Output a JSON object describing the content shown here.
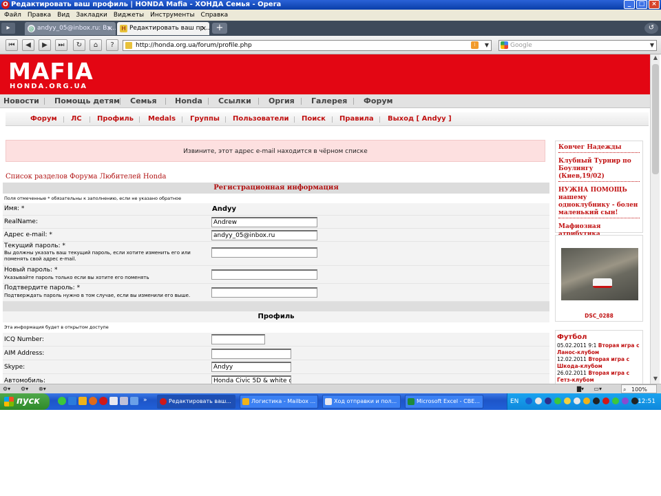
{
  "window": {
    "title": "Редактировать ваш профиль | HONDA Mafia - ХОНДА Семья - Opera",
    "controls": [
      "_",
      "□",
      "×"
    ]
  },
  "menu": [
    "Файл",
    "Правка",
    "Вид",
    "Закладки",
    "Виджеты",
    "Инструменты",
    "Справка"
  ],
  "tabs": [
    {
      "label": "andyy_05@inbox.ru: Вх...",
      "close": "×"
    },
    {
      "label": "Редактировать ваш пр...",
      "close": "×"
    }
  ],
  "new_tab": "+",
  "address": {
    "url": "http://honda.org.ua/forum/profile.php",
    "search_placeholder": "Google"
  },
  "site": {
    "logo_top": "MAFIA",
    "logo_bottom": "HONDA.ORG.UA",
    "colors": {
      "brand_red": "#e30613",
      "link_red": "#c01010"
    },
    "main_nav": [
      "Новости",
      "Помощь детям",
      "Семья",
      "Honda",
      "Ссылки",
      "Оргия",
      "Галерея",
      "Форум"
    ],
    "sub_nav": [
      "Форум",
      "ЛС",
      "Профиль",
      "Medals",
      "Группы",
      "Пользователи",
      "Поиск",
      "Правила",
      "Выход [ Andyy ]"
    ],
    "alert": "Извините, этот адрес e-mail находится в чёрном списке",
    "forum_link": "Список разделов Форума Любителей Honda"
  },
  "form": {
    "reg_header": "Регистрационная информация",
    "reg_note": "Поля отмеченные * обязательны к заполнению, если не указано обратное",
    "username_label": "Имя: *",
    "username_value": "Andyy",
    "realname_label": "RealName:",
    "realname_value": "Andrew",
    "email_label": "Адрес e-mail: *",
    "email_value": "andyy_05@inbox.ru",
    "curpass_label": "Текущий пароль: *",
    "curpass_hint": "Вы должны указать ваш текущий пароль, если хотите изменить его или поменять свой адрес e-mail.",
    "newpass_label": "Новый пароль: *",
    "newpass_hint": "Указывайте пароль только если вы хотите его поменять",
    "confpass_label": "Подтвердите пароль: *",
    "confpass_hint": "Подтверждать пароль нужно в том случае, если вы изменили его выше.",
    "profile_header": "Профиль",
    "profile_note": "Эта информация будет в открытом доступе",
    "icq_label": "ICQ Number:",
    "aim_label": "AIM Address:",
    "skype_label": "Skype:",
    "skype_value": "Andyy",
    "car_label": "Автомобиль:",
    "car_value": "Honda Civic 5D & white dor"
  },
  "sidebar": {
    "links": [
      "Ковчег Надежды",
      "Клубный Турнир по Боулингу (Киев,19/02)",
      "НУЖНА ПОМОЩЬ нашему одноклубнику - болен маленький сын!",
      "Мафиозная атрибутика"
    ],
    "photo_caption": "DSC_0288",
    "news_title": "Футбол",
    "news": [
      {
        "date": "05.02.2011 9:1",
        "text": "Вторая игра с Ланос-клубом"
      },
      {
        "date": "12.02.2011",
        "text": "Вторая игра с Шкода-клубом"
      },
      {
        "date": "26.02.2011",
        "text": "Вторая игра с Гетз-клубом"
      }
    ]
  },
  "status": {
    "zoom": "100%"
  },
  "taskbar": {
    "start": "пуск",
    "tasks": [
      "Редактировать ваш...",
      "Логистика - Mailbox ...",
      "Ход отправки и пол...",
      "Microsoft Excel - СВЕ..."
    ],
    "lang": "EN",
    "clock": "12:51"
  }
}
